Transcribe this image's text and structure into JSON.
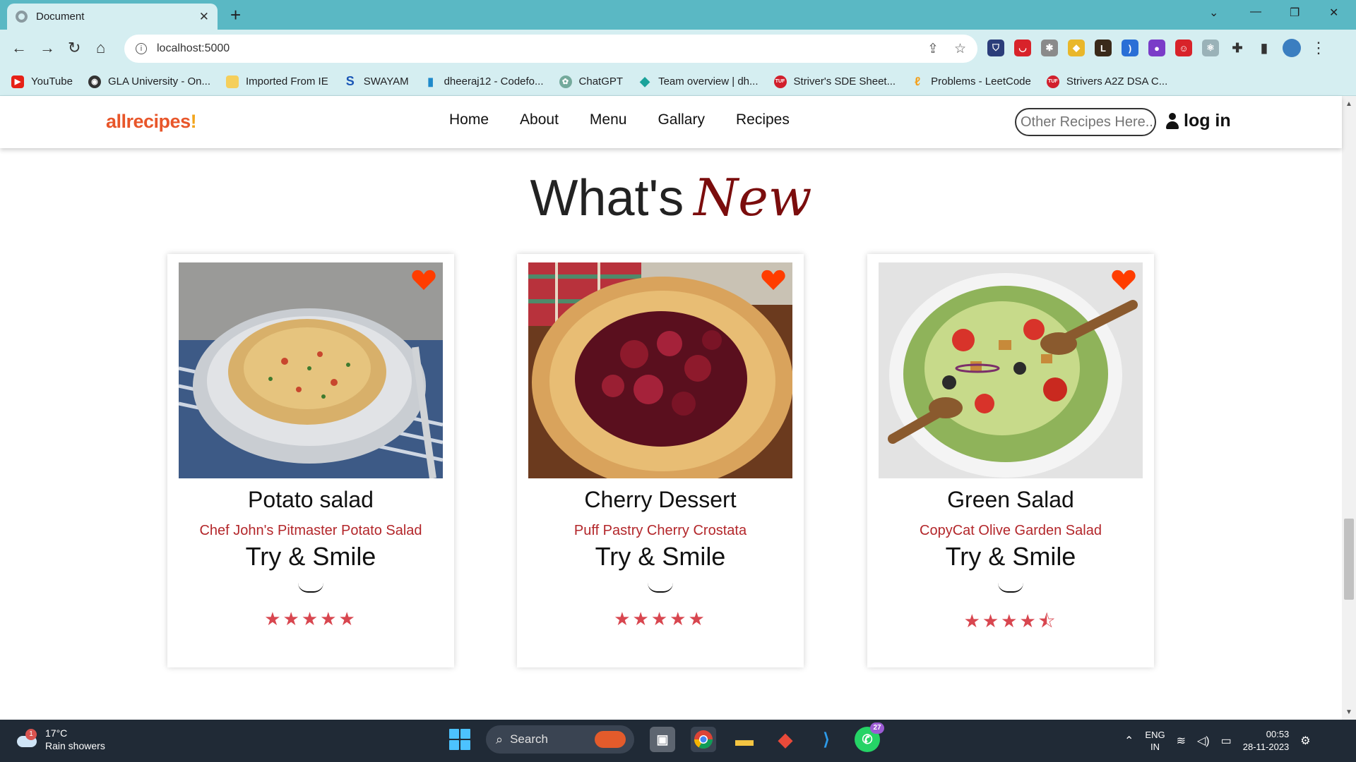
{
  "browser": {
    "tab_title": "Document",
    "new_tab": "+",
    "url": "localhost:5000",
    "bookmarks": [
      {
        "label": "YouTube",
        "icon": "youtube-icon",
        "color": "#e62117"
      },
      {
        "label": "GLA University - On...",
        "icon": "globe-icon",
        "color": "#333333"
      },
      {
        "label": "Imported From IE",
        "icon": "folder-icon",
        "color": "#f5cf5b"
      },
      {
        "label": "SWAYAM",
        "icon": "swayam-icon",
        "color": "#1a56b6"
      },
      {
        "label": "dheeraj12 - Codefo...",
        "icon": "codeforces-icon",
        "color": "#1f8acb"
      },
      {
        "label": "ChatGPT",
        "icon": "chatgpt-icon",
        "color": "#74aa9c"
      },
      {
        "label": "Team overview | dh...",
        "icon": "team-icon",
        "color": "#1aa29a"
      },
      {
        "label": "Striver's SDE Sheet...",
        "icon": "tuf-icon",
        "color": "#d11f2c"
      },
      {
        "label": "Problems - LeetCode",
        "icon": "leetcode-icon",
        "color": "#f3a01c"
      },
      {
        "label": "Strivers A2Z DSA C...",
        "icon": "tuf-icon",
        "color": "#d11f2c"
      }
    ]
  },
  "site": {
    "logo": "allrecipes",
    "logo_mark": "!",
    "menu": [
      "Home",
      "About",
      "Menu",
      "Gallary",
      "Recipes"
    ],
    "search_placeholder": "Other Recipes Here..",
    "login": "log in",
    "heading_main": "What's",
    "heading_accent": "New"
  },
  "cards": [
    {
      "name": "Potato salad",
      "subtitle": "Chef John's Pitmaster Potato Salad",
      "tagline": "Try & Smile",
      "rating": 5,
      "stars": "★★★★★"
    },
    {
      "name": "Cherry Dessert",
      "subtitle": "Puff Pastry Cherry Crostata",
      "tagline": "Try & Smile",
      "rating": 5,
      "stars": "★★★★★"
    },
    {
      "name": "Green Salad",
      "subtitle": "CopyCat Olive Garden Salad",
      "tagline": "Try & Smile",
      "rating": 4.5,
      "stars": "★★★★⯪"
    }
  ],
  "taskbar": {
    "weather_temp": "17°C",
    "weather_desc": "Rain showers",
    "weather_badge": "1",
    "search": "Search",
    "whatsapp_count": "27",
    "lang_1": "ENG",
    "lang_2": "IN",
    "time": "00:53",
    "date": "28-11-2023"
  }
}
